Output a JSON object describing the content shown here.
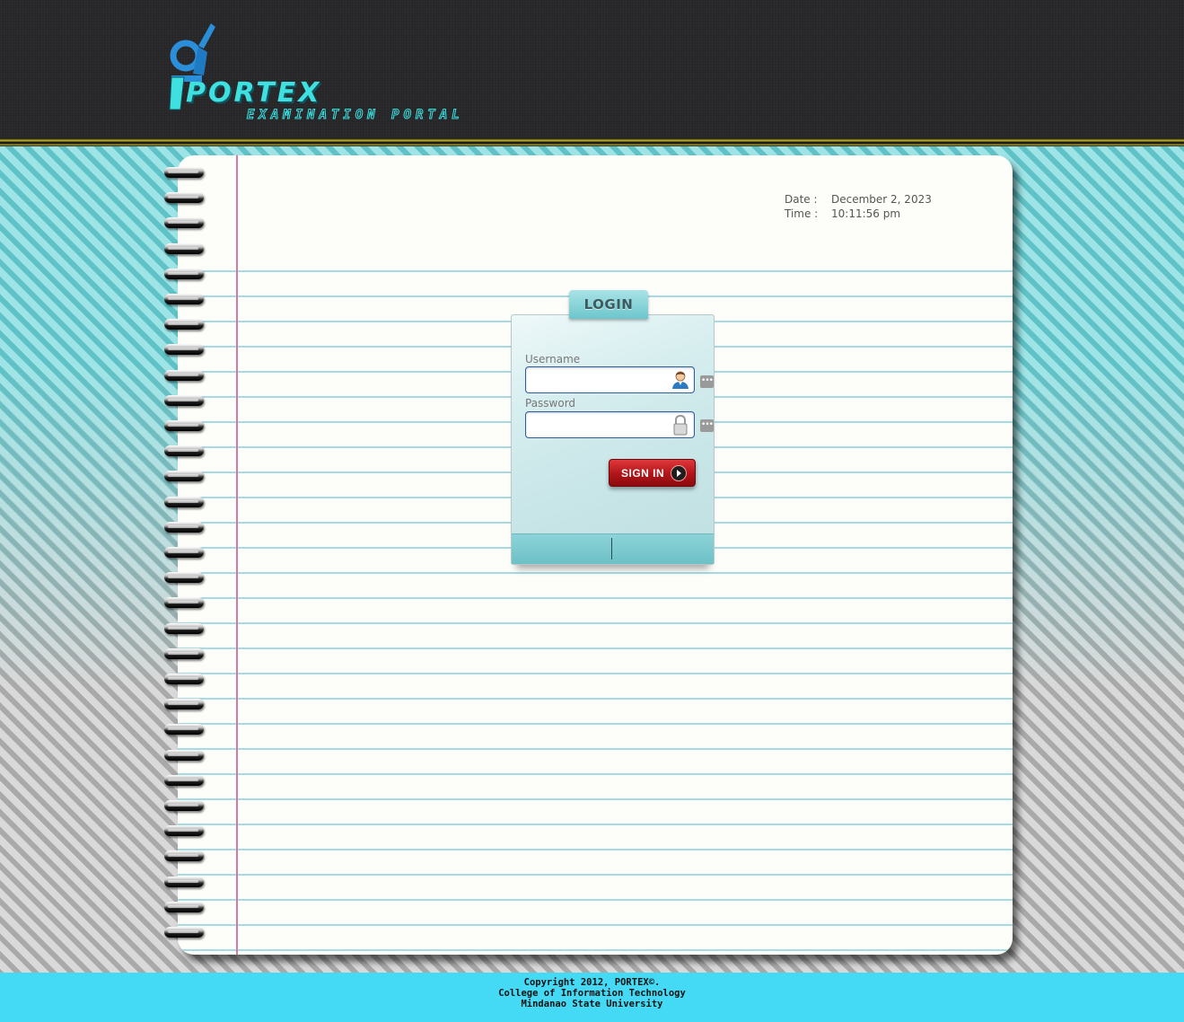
{
  "header": {
    "logo_word": "PORTEX",
    "logo_subtitle": "EXAMINATION PORTAL"
  },
  "datetime": {
    "date_label": "Date :",
    "date_value": "December 2, 2023",
    "time_label": "Time :",
    "time_value": "10:11:56 pm"
  },
  "login": {
    "tab_label": "LOGIN",
    "username_label": "Username",
    "username_value": "",
    "password_label": "Password",
    "password_value": "",
    "signin_label": "SIGN IN",
    "username_icon": "user-icon",
    "password_icon": "lock-icon",
    "more_icon": "ellipsis-icon"
  },
  "footer": {
    "line1": "Copyright 2012, PORTEX©.",
    "line2": "College of Information Technology",
    "line3": "Mindanao State University"
  },
  "colors": {
    "header_bg": "#262629",
    "accent_teal": "#3fe0e0",
    "footer_bg": "#44d9f4",
    "signin_red": "#b01418"
  }
}
